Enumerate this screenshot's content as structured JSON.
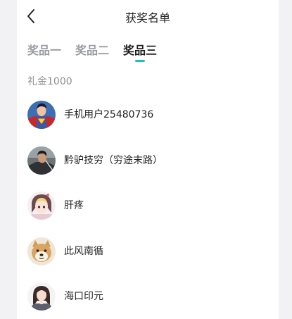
{
  "header": {
    "title": "获奖名单",
    "back_icon": "chevron-left-icon"
  },
  "tabs": [
    {
      "label": "奖品一",
      "active": false
    },
    {
      "label": "奖品二",
      "active": false
    },
    {
      "label": "奖品三",
      "active": true
    }
  ],
  "section": {
    "label": "礼金1000"
  },
  "winners": [
    {
      "name": "手机用户25480736",
      "avatar": "superman-avatar"
    },
    {
      "name": "黔驴技穷（穷途末路）",
      "avatar": "warrior-avatar"
    },
    {
      "name": "肝疼",
      "avatar": "anime-girl-avatar"
    },
    {
      "name": "此风南循",
      "avatar": "dog-avatar"
    },
    {
      "name": "海口印元",
      "avatar": "girl-avatar"
    }
  ],
  "colors": {
    "accent": "#19c2c5",
    "inactive_tab": "#9a9ca3",
    "background": "#f2f2f4"
  }
}
